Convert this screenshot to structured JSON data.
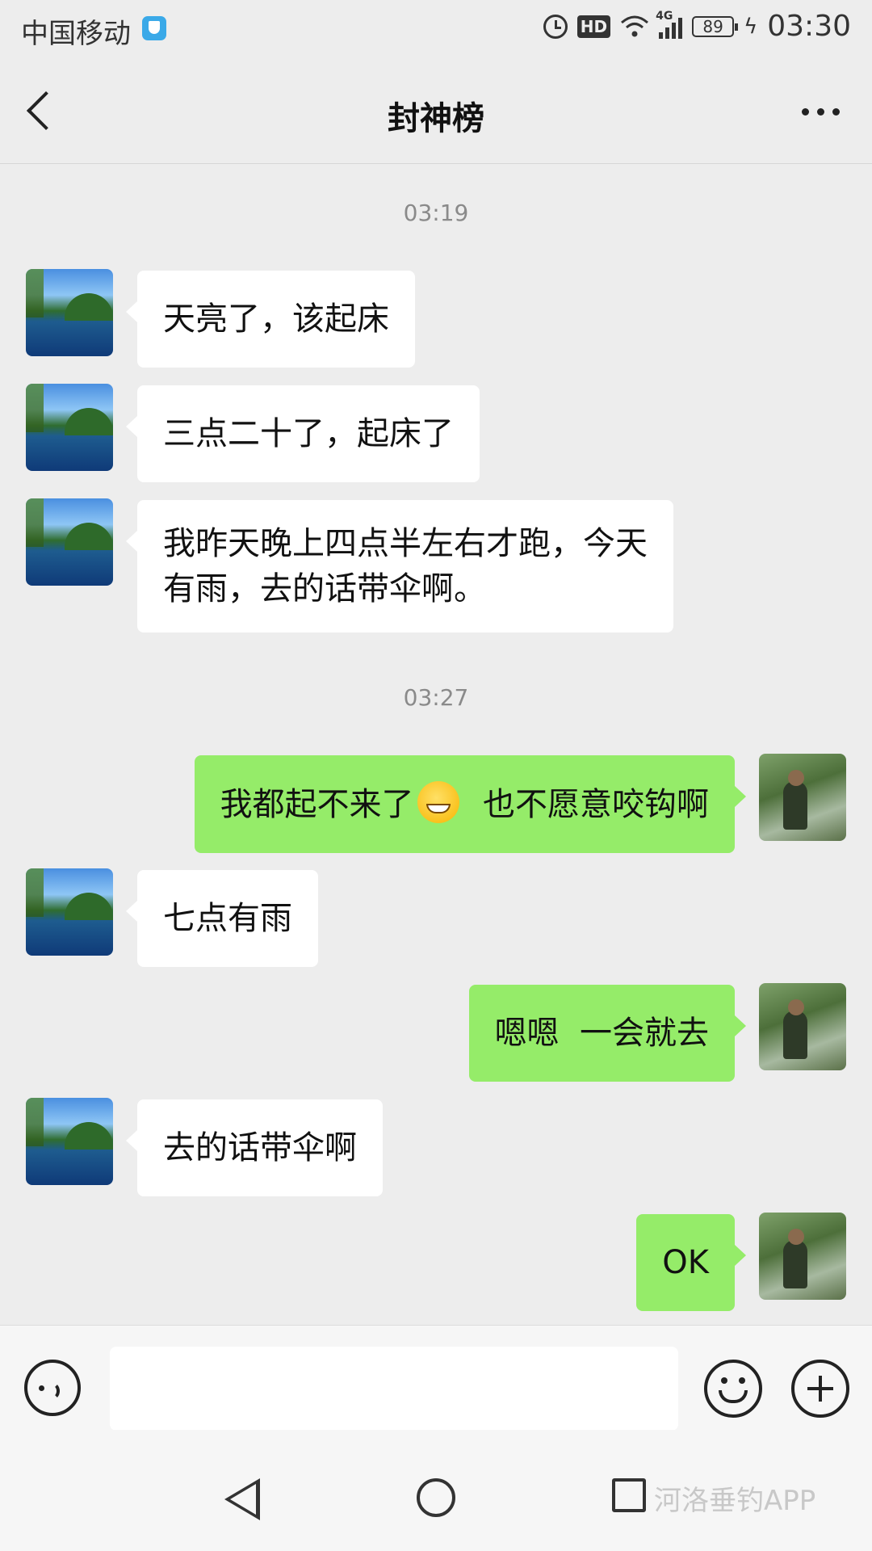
{
  "status_bar": {
    "carrier": "中国移动",
    "hd": "HD",
    "network": "4G",
    "battery": "89",
    "time": "03:30"
  },
  "header": {
    "title": "封神榜"
  },
  "messages": [
    {
      "type": "time",
      "text": "03:19"
    },
    {
      "type": "msg",
      "side": "left",
      "avatar": "lake-avatar",
      "text": "天亮了，该起床"
    },
    {
      "type": "msg",
      "side": "left",
      "avatar": "lake-avatar",
      "text": "三点二十了，起床了"
    },
    {
      "type": "msg",
      "side": "left",
      "avatar": "lake-avatar",
      "lines": [
        "我昨天晚上四点半左右才跑，今天",
        "有雨，去的话带伞啊。"
      ]
    },
    {
      "type": "time",
      "text": "03:27"
    },
    {
      "type": "msg",
      "side": "right",
      "avatar": "fisher-avatar",
      "text_before": "我都起不来了",
      "emoji": "grinning-face-icon",
      "text_after": "  也不愿意咬钩啊"
    },
    {
      "type": "msg",
      "side": "left",
      "avatar": "lake-avatar",
      "text": "七点有雨"
    },
    {
      "type": "msg",
      "side": "right",
      "avatar": "fisher-avatar",
      "text": "嗯嗯  一会就去"
    },
    {
      "type": "msg",
      "side": "left",
      "avatar": "lake-avatar",
      "text": "去的话带伞啊"
    },
    {
      "type": "msg",
      "side": "right",
      "avatar": "fisher-avatar",
      "text": "OK"
    }
  ],
  "input_bar": {
    "value": "",
    "icons": [
      "voice-icon",
      "emoji-icon",
      "plus-icon"
    ]
  },
  "nav_bar": {
    "icons": [
      "back-triangle-icon",
      "home-circle-icon",
      "recent-square-icon"
    ],
    "watermark": "河洛垂钓APP"
  },
  "colors": {
    "background": "#ededed",
    "incoming_bubble": "#ffffff",
    "outgoing_bubble": "#95ec69",
    "timestamp": "#8a8a8a"
  }
}
